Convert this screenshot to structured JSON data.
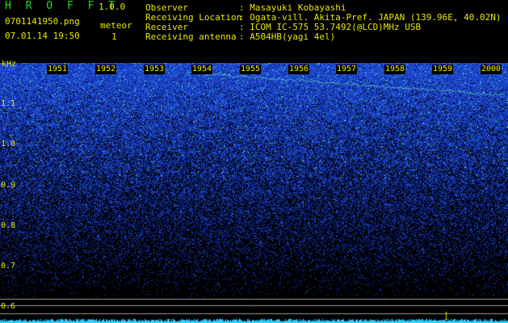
{
  "header": {
    "app_title": "H R O F F T",
    "app_version": "1.0.0",
    "file_name": "0701141950.png",
    "datetime": "07.01.14 19:50",
    "mode_label": "meteor",
    "mode_count": "1"
  },
  "info": [
    {
      "label": "Observer",
      "value": ": Masayuki Kobayashi"
    },
    {
      "label": "Receiving Location",
      "value": ": Ogata-vill. Akita-Pref. JAPAN (139.96E, 40.02N)"
    },
    {
      "label": "Receiver",
      "value": ": ICOM IC-575 53.7492(@LCD)MHz USB"
    },
    {
      "label": "Receiving antenna",
      "value": ": A504HB(yagi 4el)"
    }
  ],
  "spectrogram": {
    "y_unit": "kHz",
    "y_ticks": [
      "1.1",
      "1.0",
      "0.9",
      "0.8",
      "0.7",
      "0.6"
    ],
    "x_ticks": [
      "1951",
      "1952",
      "1953",
      "1954",
      "1955",
      "1956",
      "1957",
      "1958",
      "1959",
      "2000"
    ],
    "colors": {
      "background": "#000000",
      "noise_low": "#0a1f8c",
      "noise_high": "#2f6dff",
      "hot": "#66ffb0",
      "baseline": "#2fd0ff",
      "labels": "#e8e800"
    }
  }
}
